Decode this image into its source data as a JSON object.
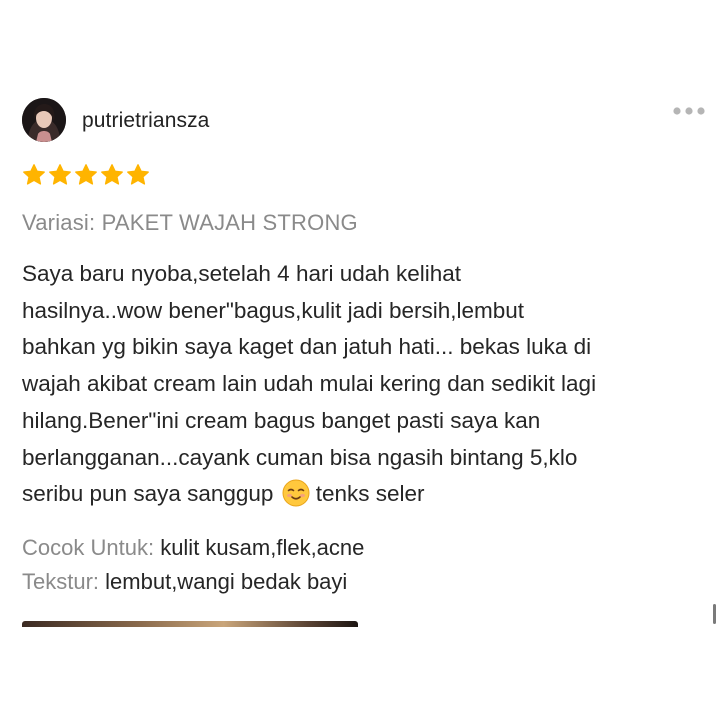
{
  "review": {
    "username": "putrietriansza",
    "rating": 5,
    "rating_max": 5,
    "variation": "Variasi: PAKET WAJAH STRONG",
    "body_lines": [
      "Saya baru nyoba,setelah 4 hari udah kelihat",
      "hasilnya..wow bener\"bagus,kulit jadi bersih,lembut",
      "bahkan yg bikin saya kaget dan jatuh hati... bekas luka di",
      "wajah akibat cream lain udah mulai kering dan sedikit lagi",
      "hilang.Bener\"ini cream bagus banget pasti saya kan",
      "berlangganan...cayank cuman bisa ngasih bintang 5,klo",
      "seribu pun saya sanggup",
      "tenks seler"
    ],
    "emoji": "smiling-face-emoji",
    "attributes": [
      {
        "label": "Cocok Untuk:",
        "value": "kulit kusam,flek,acne"
      },
      {
        "label": "Tekstur:",
        "value": "lembut,wangi bedak bayi"
      }
    ]
  },
  "icons": {
    "more": "more-horizontal-icon",
    "star": "star-icon"
  },
  "colors": {
    "star": "#FFB400",
    "muted_text": "#8A8A8A",
    "body_text": "#262626"
  }
}
